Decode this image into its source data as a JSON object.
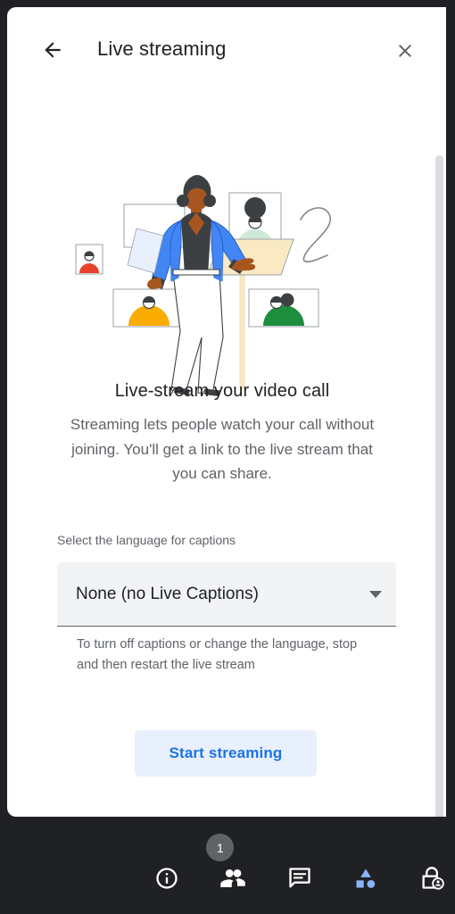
{
  "header": {
    "title": "Live streaming",
    "back_icon": "arrow-back-icon",
    "close_icon": "close-icon"
  },
  "illustration": {
    "name": "live-streaming-illustration",
    "alt": "Person presenting in front of video call tiles",
    "colors": {
      "jacket": "#4285f4",
      "skin": "#a8561f",
      "hair": "#3c4043",
      "tile_red": "#e8402a",
      "tile_yellow": "#f9ab00",
      "tile_green": "#1e8e3e",
      "tile_mint": "#ceead6",
      "easel": "#faeac4",
      "frame_stroke": "#9aa0a6"
    }
  },
  "content": {
    "headline": "Live-stream your video call",
    "description": "Streaming lets people watch your call without joining. You'll get a link to the live stream that you can share."
  },
  "caption_select": {
    "label": "Select the language for captions",
    "value": "None (no Live Captions)",
    "caret_icon": "chevron-down-icon",
    "helper_text": "To turn off captions or change the language, stop and then restart the live stream",
    "options": [
      "None (no Live Captions)"
    ]
  },
  "actions": {
    "start_streaming": "Start streaming"
  },
  "scrollbar": {
    "name": "panel-scrollbar"
  },
  "bottom_bar": {
    "items": [
      {
        "name": "meeting-details-button",
        "icon": "info-icon",
        "badge": null
      },
      {
        "name": "people-button",
        "icon": "people-icon",
        "badge": "1"
      },
      {
        "name": "chat-button",
        "icon": "chat-icon",
        "badge": null
      },
      {
        "name": "activities-button",
        "icon": "activities-icon",
        "badge": null
      },
      {
        "name": "host-controls-button",
        "icon": "lock-person-icon",
        "badge": null
      }
    ],
    "accent_color": "#8ab4f8",
    "icon_color": "#ffffff",
    "badge_color": "#5f6368"
  }
}
